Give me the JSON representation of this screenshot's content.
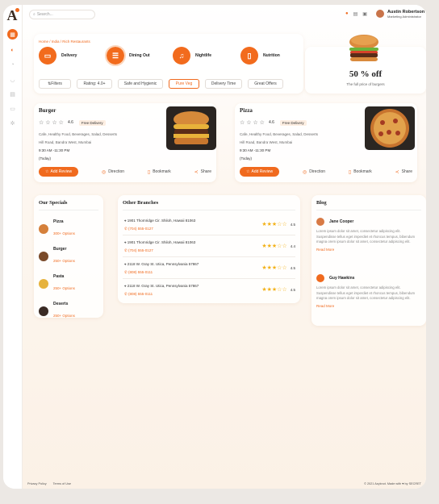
{
  "brand": {
    "logo": "A"
  },
  "sidebar": {
    "icons": [
      "grid-icon",
      "pizza-icon",
      "chart-icon",
      "bowl-icon",
      "file-icon",
      "wallet-icon",
      "settings-icon"
    ]
  },
  "topbar": {
    "search_placeholder": "Search...",
    "user_name": "Austin Robertson",
    "user_role": "Marketing Administrator"
  },
  "breadcrumb": "Home / India / Rich Restaurants",
  "categories": [
    "Delivery",
    "Dining Out",
    "Nightlife",
    "Nutrition"
  ],
  "filters": [
    "Filters",
    "Rating: 4.0+",
    "Safe and Hygienic",
    "Pure Veg",
    "Delivery Time",
    "Great Offers"
  ],
  "promo": {
    "title": "50 % off",
    "subtitle": "The full price of burgers"
  },
  "restaurants": [
    {
      "name": "Burger",
      "rating": "4.6",
      "badge": "Free Delivery",
      "tags": "Cafe, Healthy Food, Beverages, Salad, Desserts",
      "address": "Hill Road, Bandra West, Mumbai",
      "hours": "9:30 AM -11:30 PM",
      "day": "(Today)"
    },
    {
      "name": "Pizza",
      "rating": "4.6",
      "badge": "Free Delivery",
      "tags": "Cafe, Healthy Food, Beverages, Salad, Desserts",
      "address": "Hill Road, Bandra West, Mumbai",
      "hours": "9:30 AM -11:30 PM",
      "day": "(Today)"
    }
  ],
  "actions": {
    "review": "Add Review",
    "direction": "Direction",
    "bookmark": "Bookmark",
    "share": "Share"
  },
  "specials": {
    "title": "Our Specials",
    "items": [
      {
        "name": "Pizza",
        "options": "300+ Options"
      },
      {
        "name": "Burger",
        "options": "250+ Options"
      },
      {
        "name": "Pasta",
        "options": "250+ Options"
      },
      {
        "name": "Deserts",
        "options": "250+ Options"
      }
    ]
  },
  "branches": {
    "title": "Other Branches",
    "items": [
      {
        "address": "1901 Thornridge Cir. Shiloh, Hawaii 81063",
        "phone": "(704) 555-0127",
        "rating": "4.5"
      },
      {
        "address": "1901 Thornridge Cir. Shiloh, Hawaii 81063",
        "phone": "(704) 555-0127",
        "rating": "4.4"
      },
      {
        "address": "2118 W. Gray St. Utica, Pennsylvania 57867",
        "phone": "(808) 555-0111",
        "rating": "4.5"
      },
      {
        "address": "2118 W. Gray St. Utica, Pennsylvania 57867",
        "phone": "(808) 555-0111",
        "rating": "4.5"
      }
    ]
  },
  "blog": {
    "title": "Blog",
    "posts": [
      {
        "author": "Jane Cooper",
        "text": "Lorem ipsum dolor sit amet, consectetur adipiscing elit. Suspendisse tellus eget imperdiet et rhoncus tempus, bibendum magna orem ipsum dolor sit amet, consectetur adipiscing elit.",
        "more": "Read More"
      },
      {
        "author": "Guy Hawkins",
        "text": "Lorem ipsum dolor sit amet, consectetur adipiscing elit. Suspendisse tellus eget imperdiet et rhoncus tempus, bibendum magna orem ipsum dolor sit amet, consectetur adipiscing elit.",
        "more": "Read More"
      }
    ]
  },
  "footer": {
    "privacy": "Privacy Policy",
    "terms": "Terms of Use",
    "copyright": "© 2021 Azyknot. Made with ♥ by SECRET"
  },
  "colors": {
    "accent": "#f06a1e",
    "star": "#f3b21a"
  }
}
